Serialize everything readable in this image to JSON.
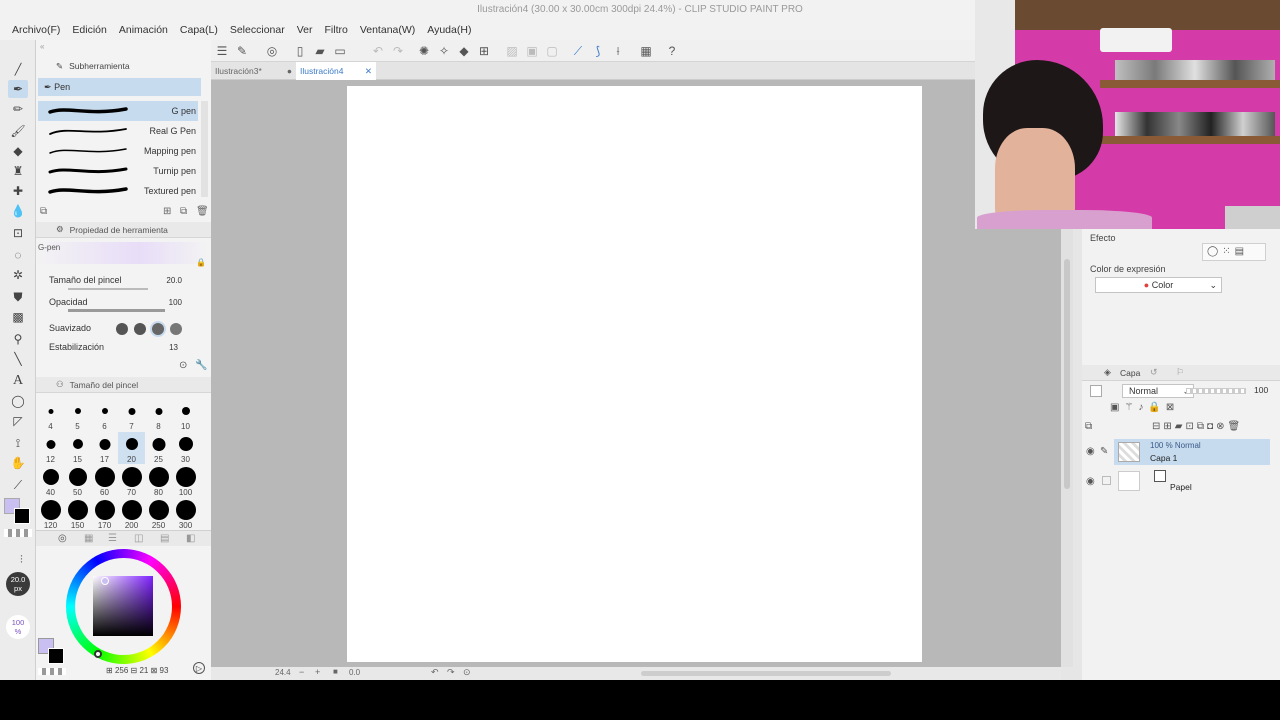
{
  "title": "Ilustración4 (30.00 x 30.00cm 300dpi 24.4%)  - CLIP STUDIO PAINT PRO",
  "menu": [
    "Archivo(F)",
    "Edición",
    "Animación",
    "Capa(L)",
    "Seleccionar",
    "Ver",
    "Filtro",
    "Ventana(W)",
    "Ayuda(H)"
  ],
  "tabs": [
    {
      "label": "Ilustración3*"
    },
    {
      "label": "Ilustración4"
    }
  ],
  "subtool": {
    "header": "Subherramienta",
    "group": "Pen",
    "brushes": [
      "G pen",
      "Real G Pen",
      "Mapping pen",
      "Turnip pen",
      "Textured pen"
    ],
    "selected": "G pen"
  },
  "toolprop": {
    "header": "Propiedad de herramienta",
    "preset": "G-pen",
    "rows": [
      {
        "label": "Tamaño del pincel",
        "value": "20.0"
      },
      {
        "label": "Opacidad",
        "value": "100"
      },
      {
        "label": "Suavizado",
        "value": ""
      },
      {
        "label": "Estabilización",
        "value": "13"
      }
    ]
  },
  "brushsize": {
    "header": "Tamaño del pincel",
    "sizes": [
      "4",
      "5",
      "6",
      "7",
      "8",
      "10",
      "12",
      "15",
      "17",
      "20",
      "25",
      "30",
      "40",
      "50",
      "60",
      "70",
      "80",
      "100",
      "120",
      "150",
      "170",
      "200",
      "250",
      "300"
    ],
    "selected": "20"
  },
  "leftstatus": {
    "size": "20.0",
    "size_unit": "px",
    "opacity": "100",
    "opacity_unit": "%"
  },
  "colorwheel": {
    "readout_h": "256",
    "readout_s": "21",
    "readout_v": "93"
  },
  "zoom": "24.4",
  "angle": "0.0",
  "rightpanel": {
    "effect_label": "Efecto",
    "expr_label": "Color de expresión",
    "expr_value": "Color",
    "layer_tab": "Capa",
    "blend_mode": "Normal",
    "opacity": "100",
    "layers": [
      {
        "mode": "100 % Normal",
        "name": "Capa 1"
      },
      {
        "mode": "",
        "name": "Papel"
      }
    ]
  },
  "colors": {
    "accent": "#3b7bc8",
    "selected_bg": "#c7dbef",
    "main_color": "#c9bff0",
    "canvas_bg": "#b8b8b8",
    "wall": "#d53aa9"
  }
}
